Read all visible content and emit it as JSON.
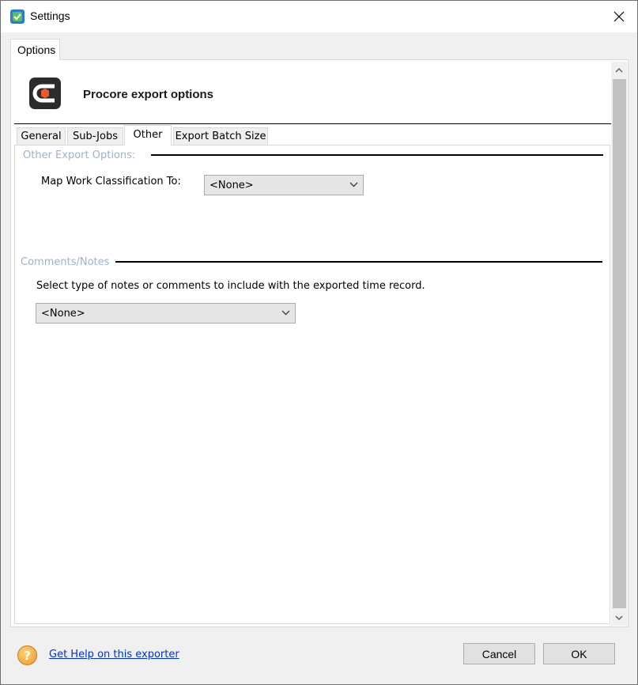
{
  "window": {
    "title": "Settings"
  },
  "outer_tab": {
    "label": "Options"
  },
  "header": {
    "title": "Procore export options"
  },
  "tabs": [
    {
      "label": "General",
      "active": false
    },
    {
      "label": "Sub-Jobs",
      "active": false
    },
    {
      "label": "Other",
      "active": true
    },
    {
      "label": "Export Batch Size",
      "active": false
    }
  ],
  "other_export": {
    "group_label": "Other Export Options:",
    "map_label": "Map Work Classification To:",
    "map_value": "<None>"
  },
  "comments": {
    "group_label": "Comments/Notes",
    "description": "Select type of notes or comments to include with the exported time record.",
    "value": "<None>"
  },
  "footer": {
    "help_link": "Get Help on this exporter",
    "cancel_label": "Cancel",
    "ok_label": "OK"
  },
  "colors": {
    "logo_bg": "#2b2b2b",
    "logo_accent": "#f05a28",
    "group_label": "#9fb1cc",
    "link": "#0033cc"
  },
  "icons": {
    "app": "settings-check-icon",
    "close": "close-icon",
    "dropdown": "chevron-down-icon",
    "help": "help-icon"
  }
}
